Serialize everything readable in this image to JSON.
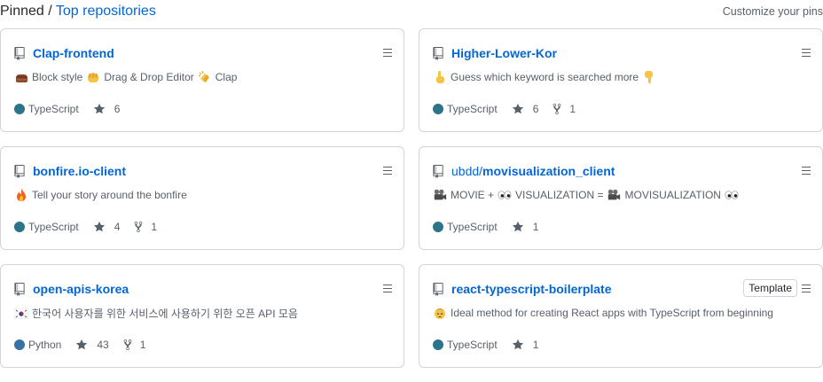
{
  "header": {
    "prefix": "Pinned",
    "separator": " / ",
    "link": "Top repositories",
    "customize": "Customize your pins"
  },
  "colors": {
    "link": "#0366d6",
    "muted": "#586069",
    "border": "#d1d5da",
    "typescript": "#2b7489",
    "python": "#3572A5"
  },
  "repos": [
    {
      "name": "Clap-frontend",
      "description": [
        {
          "emoji": "brick-icon"
        },
        {
          "text": "Block style"
        },
        {
          "emoji": "fist-icon"
        },
        {
          "text": "Drag & Drop Editor"
        },
        {
          "emoji": "clap-icon"
        },
        {
          "text": "Clap"
        }
      ],
      "language": "TypeScript",
      "stars": "6",
      "forks": null
    },
    {
      "name": "Higher-Lower-Kor",
      "description": [
        {
          "emoji": "point-up-icon"
        },
        {
          "text": "Guess which keyword is searched more"
        },
        {
          "emoji": "point-down-icon"
        }
      ],
      "language": "TypeScript",
      "stars": "6",
      "forks": "1"
    },
    {
      "name": "bonfire.io-client",
      "description": [
        {
          "emoji": "fire-icon"
        },
        {
          "text": "Tell your story around the bonfire"
        }
      ],
      "language": "TypeScript",
      "stars": "4",
      "forks": "1"
    },
    {
      "owner": "ubdd/",
      "name": "movisualization_client",
      "description": [
        {
          "emoji": "camera-icon"
        },
        {
          "text": "MOVIE +"
        },
        {
          "emoji": "eyes-icon"
        },
        {
          "text": "VISUALIZATION ="
        },
        {
          "emoji": "camera-icon"
        },
        {
          "text": "MOVISUALIZATION"
        },
        {
          "emoji": "eyes-icon"
        }
      ],
      "language": "TypeScript",
      "stars": "1",
      "forks": null
    },
    {
      "name": "open-apis-korea",
      "description": [
        {
          "emoji": "korea-flag-icon"
        },
        {
          "text": "한국어 사용자를 위한 서비스에 사용하기 위한 오픈 API 모음"
        }
      ],
      "language": "Python",
      "stars": "43",
      "forks": "1"
    },
    {
      "name": "react-typescript-boilerplate",
      "badge": "Template",
      "description": [
        {
          "emoji": "baby-icon"
        },
        {
          "text": "Ideal method for creating React apps with TypeScript from beginning"
        }
      ],
      "language": "TypeScript",
      "stars": "1",
      "forks": null
    }
  ]
}
